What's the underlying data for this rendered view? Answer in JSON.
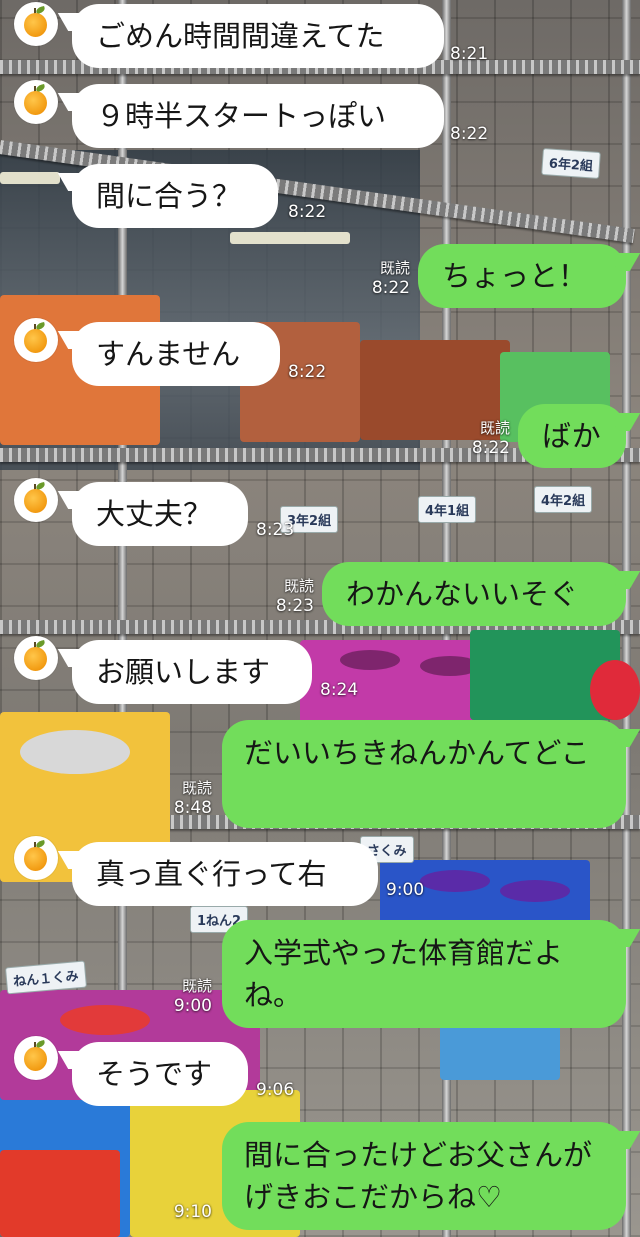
{
  "conversation": {
    "read_label": "既読",
    "messages": [
      {
        "side": "in",
        "text": "ごめん時間間違えてた",
        "time": "8:21"
      },
      {
        "side": "in",
        "text": "９時半スタートっぽい",
        "time": "8:22"
      },
      {
        "side": "in",
        "text": "間に合う？",
        "time": "8:22"
      },
      {
        "side": "out",
        "text": "ちょっと！",
        "time": "8:22",
        "read": true
      },
      {
        "side": "in",
        "text": "すんません",
        "time": "8:22"
      },
      {
        "side": "out",
        "text": "ばか",
        "time": "8:22",
        "read": true
      },
      {
        "side": "in",
        "text": "大丈夫？",
        "time": "8:23"
      },
      {
        "side": "out",
        "text": "わかんないいそぐ",
        "time": "8:23",
        "read": true
      },
      {
        "side": "in",
        "text": "お願いします",
        "time": "8:24"
      },
      {
        "side": "out",
        "text": "だいいちきねんかんてどこ",
        "time": "8:48",
        "read": true
      },
      {
        "side": "in",
        "text": "真っ直ぐ行って右",
        "time": "9:00"
      },
      {
        "side": "out",
        "text": "入学式やった体育館だよね。",
        "time": "9:00",
        "read": true
      },
      {
        "side": "in",
        "text": "そうです",
        "time": "9:06"
      },
      {
        "side": "out",
        "text": "間に合ったけどお父さんがげきおこだからね♡",
        "time": "9:10",
        "read": false
      }
    ]
  },
  "background": {
    "shelf_tags": [
      "6年2組",
      "3年2組",
      "4年1組",
      "4年2組",
      "1ねん2",
      "ねん１くみ",
      "さくみ"
    ]
  },
  "avatar_icon": "orange-fruit-icon",
  "colors": {
    "incoming_bubble": "#ffffff",
    "outgoing_bubble": "#72dd5b",
    "meta_text": "#ffffff"
  }
}
